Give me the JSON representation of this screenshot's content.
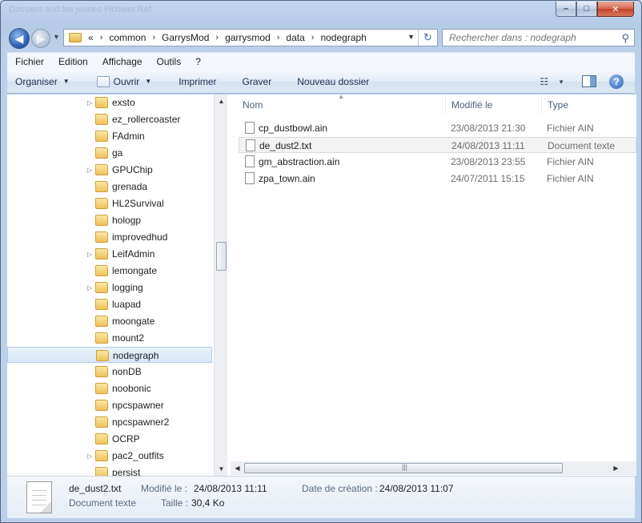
{
  "window": {
    "ghost_title": "Dossiers     sud les jeunes  Fichiers Ref"
  },
  "window_controls": {
    "minimize": "–",
    "maximize": "□",
    "close": "✕"
  },
  "address": {
    "overflow": "«",
    "breadcrumbs": [
      "common",
      "GarrysMod",
      "garrysmod",
      "data",
      "nodegraph"
    ]
  },
  "search": {
    "placeholder": "Rechercher dans : nodegraph"
  },
  "menubar": {
    "items": [
      "Fichier",
      "Edition",
      "Affichage",
      "Outils",
      "?"
    ]
  },
  "toolbar": {
    "organize": "Organiser",
    "open": "Ouvrir",
    "print": "Imprimer",
    "burn": "Graver",
    "new_folder": "Nouveau dossier"
  },
  "tree": {
    "items": [
      {
        "label": "exsto",
        "expandable": true
      },
      {
        "label": "ez_rollercoaster",
        "expandable": false
      },
      {
        "label": "FAdmin",
        "expandable": false
      },
      {
        "label": "ga",
        "expandable": false
      },
      {
        "label": "GPUChip",
        "expandable": true
      },
      {
        "label": "grenada",
        "expandable": false
      },
      {
        "label": "HL2Survival",
        "expandable": false
      },
      {
        "label": "hologp",
        "expandable": false
      },
      {
        "label": "improvedhud",
        "expandable": false
      },
      {
        "label": "LeifAdmin",
        "expandable": true
      },
      {
        "label": "lemongate",
        "expandable": false
      },
      {
        "label": "logging",
        "expandable": true
      },
      {
        "label": "luapad",
        "expandable": false
      },
      {
        "label": "moongate",
        "expandable": false
      },
      {
        "label": "mount2",
        "expandable": false
      },
      {
        "label": "nodegraph",
        "expandable": false,
        "selected": true
      },
      {
        "label": "nonDB",
        "expandable": false
      },
      {
        "label": "noobonic",
        "expandable": false
      },
      {
        "label": "npcspawner",
        "expandable": false
      },
      {
        "label": "npcspawner2",
        "expandable": false
      },
      {
        "label": "OCRP",
        "expandable": false
      },
      {
        "label": "pac2_outfits",
        "expandable": true
      },
      {
        "label": "persist",
        "expandable": false
      }
    ]
  },
  "columns": {
    "name": "Nom",
    "modified": "Modifié le",
    "type": "Type"
  },
  "files": [
    {
      "name": "cp_dustbowl.ain",
      "modified": "23/08/2013 21:30",
      "type": "Fichier AIN"
    },
    {
      "name": "de_dust2.txt",
      "modified": "24/08/2013 11:11",
      "type": "Document texte",
      "hover": true
    },
    {
      "name": "gm_abstraction.ain",
      "modified": "23/08/2013 23:55",
      "type": "Fichier AIN"
    },
    {
      "name": "zpa_town.ain",
      "modified": "24/07/2011 15:15",
      "type": "Fichier AIN"
    }
  ],
  "details": {
    "name": "de_dust2.txt",
    "kind": "Document texte",
    "modified_label": "Modifié le :",
    "modified_value": "24/08/2013 11:11",
    "created_label": "Date de création :",
    "created_value": "24/08/2013 11:07",
    "size_label": "Taille :",
    "size_value": "30,4 Ko"
  },
  "icons": {
    "back": "◀",
    "forward": "▶",
    "history": "▼",
    "dropdown": "▼",
    "refresh": "↻",
    "search": "⚲",
    "help": "?",
    "view": "☷",
    "tree_expand": "▷",
    "scroll_up": "▲",
    "scroll_down": "▼",
    "scroll_left": "◀",
    "scroll_right": "▶",
    "grip": "|||",
    "sort": "▲"
  }
}
